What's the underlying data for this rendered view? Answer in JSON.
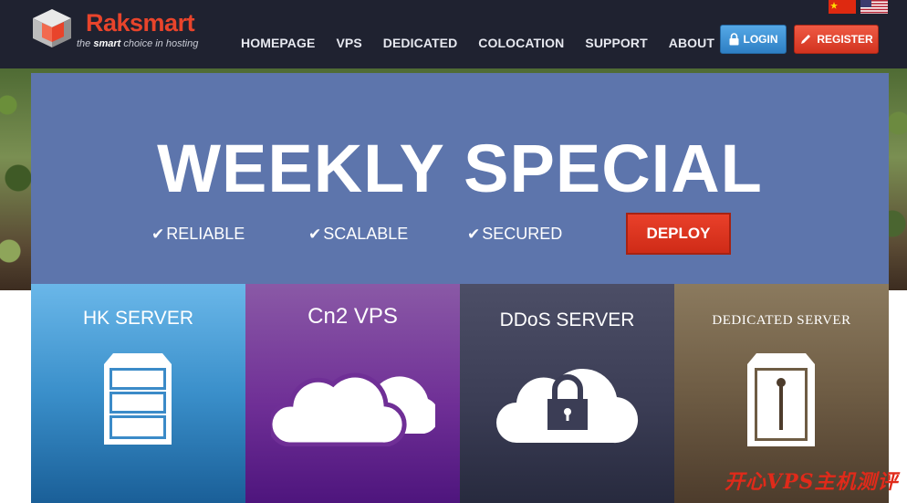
{
  "brand": {
    "name": "Raksmart",
    "tagline_pre": "the ",
    "tagline_bold": "smart",
    "tagline_post": " choice in hosting",
    "accent": "#e8442b"
  },
  "nav": {
    "items": [
      {
        "label": "HOMEPAGE"
      },
      {
        "label": "VPS"
      },
      {
        "label": "DEDICATED"
      },
      {
        "label": "COLOCATION"
      },
      {
        "label": "SUPPORT"
      },
      {
        "label": "ABOUT"
      }
    ]
  },
  "auth": {
    "login_label": "LOGIN",
    "register_label": "REGISTER"
  },
  "languages": {
    "flags": [
      "cn-flag-icon",
      "us-flag-icon"
    ]
  },
  "hero": {
    "title": "WEEKLY SPECIAL",
    "features": [
      "RELIABLE",
      "SCALABLE",
      "SECURED"
    ],
    "cta_label": "DEPLOY",
    "panel_color": "#5d75ac"
  },
  "cards": [
    {
      "title": "HK SERVER",
      "icon": "server-rack-icon"
    },
    {
      "title": "Cn2 VPS",
      "icon": "cloud-icon"
    },
    {
      "title": "DDoS SERVER",
      "icon": "cloud-lock-icon"
    },
    {
      "title": "DEDICATED SERVER",
      "icon": "dedicated-server-icon"
    }
  ],
  "watermark": {
    "text": "开心VPS主机测评"
  }
}
